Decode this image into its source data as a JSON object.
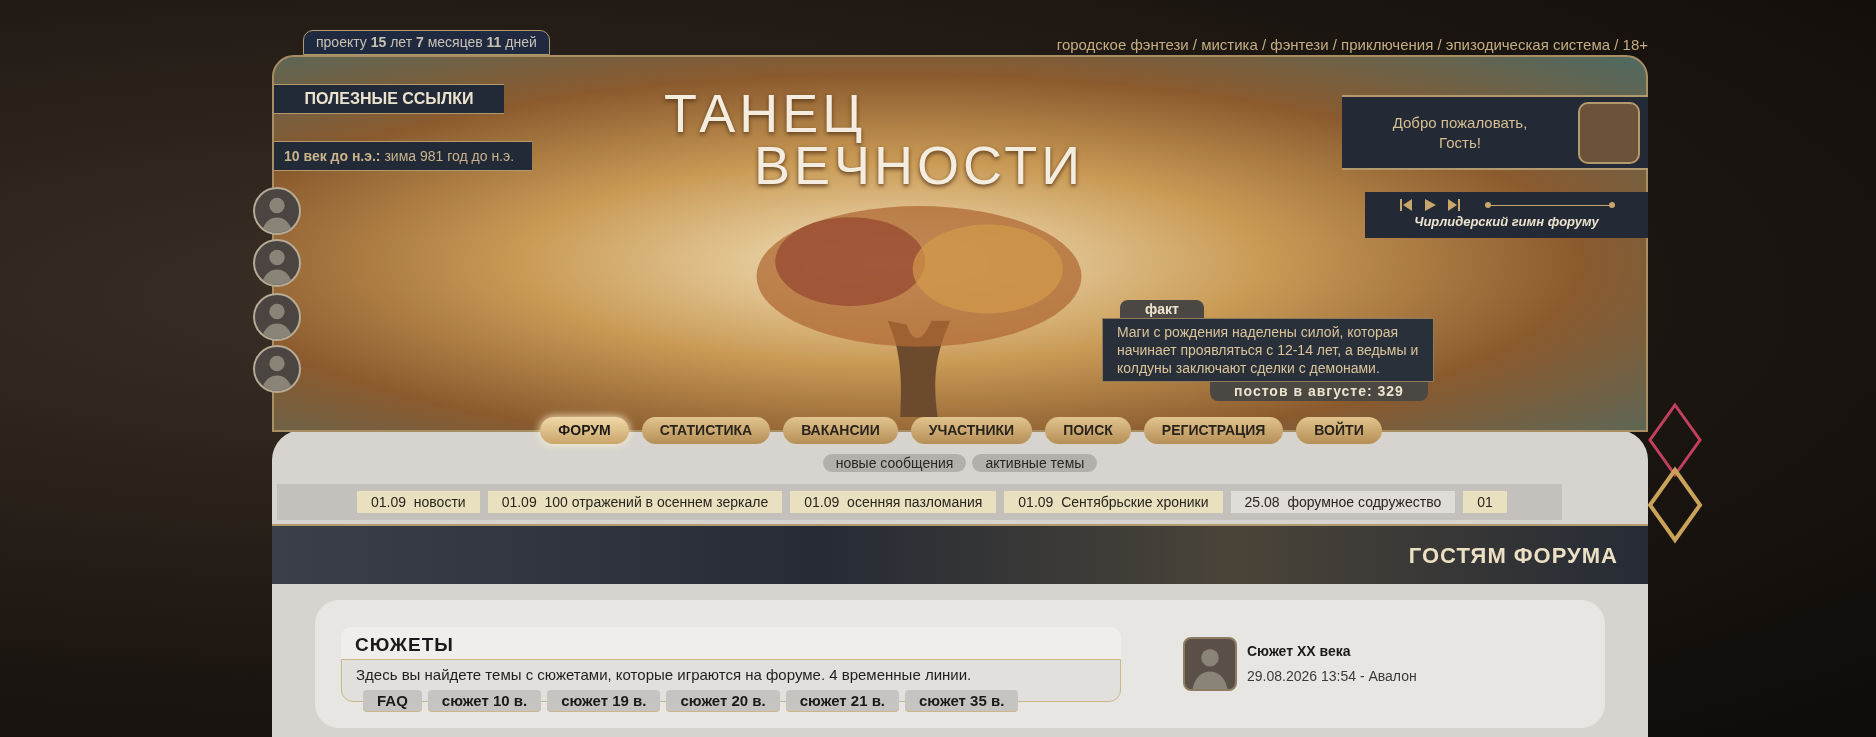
{
  "top_bar": {
    "project_age": "проекту **15** лет **7** месяцев **11** дней",
    "genres": "городское фэнтези / мистика / фэнтези / приключения / эпизодическая система / 18+"
  },
  "header": {
    "useful_links": "ПОЛЕЗНЫЕ ССЫЛКИ",
    "game_date": "**10 век до н.э.:** зима 981 год до н.э.",
    "logo_lines": [
      "ТАНЕЦ",
      "ВЕЧНОСТИ"
    ],
    "welcome_lines": [
      "Добро пожаловать,",
      "Гость!"
    ],
    "player": {
      "track": "Чирлидерский гимн форуму",
      "level": 0
    }
  },
  "fact": {
    "label": "факт",
    "text": "Маги с рождения наделены силой, которая начинает проявляться с 12-14 лет, а ведьмы и колдуны заключают сделки с демонами.",
    "posts": "постов в августе: 329"
  },
  "nav": [
    {
      "label": "ФОРУМ",
      "selected": true
    },
    {
      "label": "СТАТИСТИКА",
      "selected": false
    },
    {
      "label": "ВАКАНСИИ",
      "selected": false
    },
    {
      "label": "УЧАСТНИКИ",
      "selected": false
    },
    {
      "label": "ПОИСК",
      "selected": false
    },
    {
      "label": "РЕГИСТРАЦИЯ",
      "selected": false
    },
    {
      "label": "ВОЙТИ",
      "selected": false
    }
  ],
  "sub_links": [
    "новые сообщения",
    "активные темы"
  ],
  "news": [
    {
      "date": "01.09",
      "title": "новости",
      "recent": true
    },
    {
      "date": "01.09",
      "title": "100 отражений в осеннем зеркале",
      "recent": true
    },
    {
      "date": "01.09",
      "title": "осенняя пазломания",
      "recent": true
    },
    {
      "date": "01.09",
      "title": "Сентябрьские хроники",
      "recent": true
    },
    {
      "date": "25.08",
      "title": "форумное содружество",
      "recent": false
    },
    {
      "date": "01",
      "recent": true
    }
  ],
  "section_title": "ГОСТЯМ ФОРУМА",
  "forum": {
    "title": "СЮЖЕТЫ",
    "description": "Здесь вы найдете темы с сюжетами, которые играются на форуме. 4 временные линии.",
    "subforums": [
      "FAQ",
      "сюжет 10 в.",
      "сюжет 19 в.",
      "сюжет 20 в.",
      "сюжет 21 в.",
      "сюжет 35 в."
    ],
    "last_post": {
      "topic": "Сюжет XX века",
      "meta": "29.08.2026 13:54 - Авалон"
    }
  }
}
